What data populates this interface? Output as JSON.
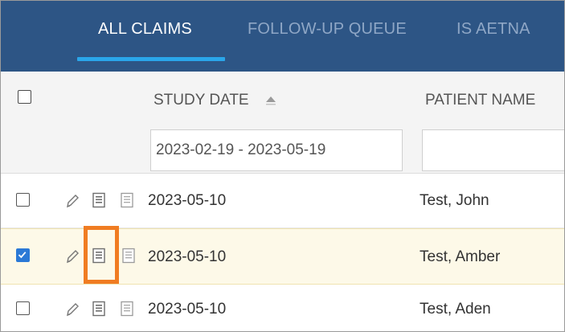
{
  "tabs": [
    {
      "label": "ALL CLAIMS",
      "active": true
    },
    {
      "label": "FOLLOW-UP QUEUE",
      "active": false
    },
    {
      "label": "IS AETNA",
      "active": false
    }
  ],
  "columns": {
    "study_date": {
      "title": "STUDY DATE",
      "filter_value": "2023-02-19 - 2023-05-19",
      "sort": "ascending"
    },
    "patient_name": {
      "title": "PATIENT NAME",
      "filter_value": ""
    }
  },
  "rows": [
    {
      "checked": false,
      "study_date": "2023-05-10",
      "patient_name": "Test, John"
    },
    {
      "checked": true,
      "study_date": "2023-05-10",
      "patient_name": "Test, Amber"
    },
    {
      "checked": false,
      "study_date": "2023-05-10",
      "patient_name": "Test, Aden"
    }
  ],
  "icons": [
    "edit-pencil-icon",
    "claim-document-icon",
    "notes-document-icon",
    "sort-ascending-icon",
    "checkmark-icon"
  ],
  "colors": {
    "tabbar_bg": "#2d5585",
    "tab_active": "#ffffff",
    "tab_inactive": "#8fa7c6",
    "tab_underline": "#2aa6ea",
    "selected_row_bg": "#fdf9e8",
    "checkbox_checked": "#2b79d6",
    "highlight_outline": "#f07c22"
  }
}
